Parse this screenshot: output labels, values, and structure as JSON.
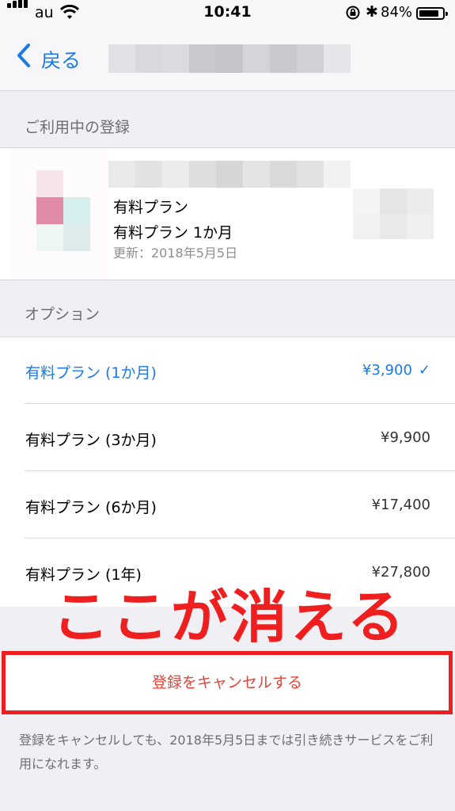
{
  "status_bar": {
    "carrier": "au",
    "time": "10:41",
    "battery_text": "84%",
    "battery_level": 0.84,
    "icons": [
      "signal-icon",
      "wifi-icon",
      "rotation-lock-icon",
      "bluetooth-icon",
      "battery-icon"
    ]
  },
  "nav": {
    "back_label": "戻る"
  },
  "current": {
    "section_title": "ご利用中の登録",
    "plan_name": "有料プラン",
    "plan_detail": "有料プラン 1か月",
    "renewal": "更新：2018年5月5日"
  },
  "options": {
    "section_title": "オプション",
    "items": [
      {
        "name": "有料プラン (1か月)",
        "price": "¥3,900",
        "selected": true
      },
      {
        "name": "有料プラン (3か月)",
        "price": "¥9,900",
        "selected": false
      },
      {
        "name": "有料プラン (6か月)",
        "price": "¥17,400",
        "selected": false
      },
      {
        "name": "有料プラン (1年)",
        "price": "¥27,800",
        "selected": false
      }
    ]
  },
  "annotation": "ここが消える",
  "cancel_label": "登録をキャンセルする",
  "footer_note": "登録をキャンセルしても、2018年5月5日までは引き続きサービスをご利用になれます。",
  "colors": {
    "accent": "#1a7ae6",
    "annotation_red": "#ef1f1f",
    "cancel_text": "#e0453a",
    "background": "#efeff4"
  }
}
